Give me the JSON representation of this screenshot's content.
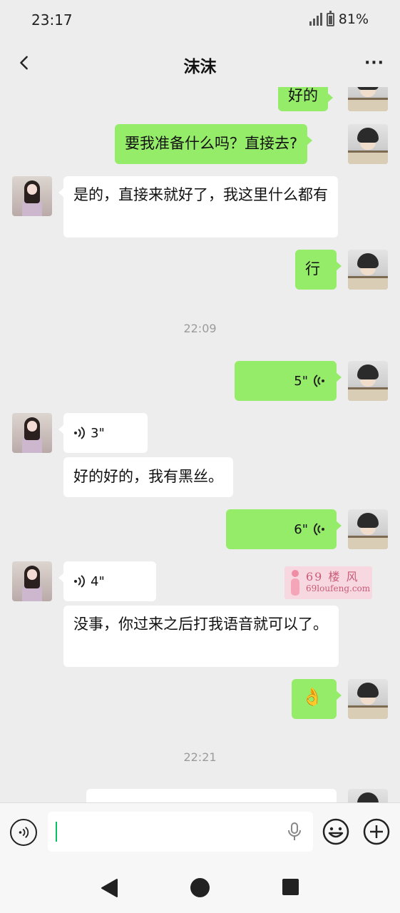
{
  "status_bar": {
    "time": "23:17",
    "battery_percent": "81%",
    "signal_icon": "cellular-signal-icon",
    "battery_icon": "battery-icon"
  },
  "nav": {
    "title": "沫沫",
    "back_icon": "chevron-left-icon",
    "more_label": "···"
  },
  "messages": [
    {
      "from": "me",
      "type": "text",
      "text": "好的"
    },
    {
      "from": "me",
      "type": "text",
      "text": "要我准备什么吗？直接去?"
    },
    {
      "from": "her",
      "type": "text",
      "text": "是的，直接来就好了，我这里什么都有"
    },
    {
      "from": "me",
      "type": "text",
      "text": "行"
    },
    {
      "type": "timestamp",
      "text": "22:09"
    },
    {
      "from": "me",
      "type": "voice",
      "duration": "5\""
    },
    {
      "from": "her",
      "type": "voice",
      "duration": "3\""
    },
    {
      "from": "her",
      "type": "text",
      "text": "好的好的，我有黑丝。"
    },
    {
      "from": "me",
      "type": "voice",
      "duration": "6\""
    },
    {
      "from": "her",
      "type": "voice",
      "duration": "4\""
    },
    {
      "from": "her",
      "type": "text",
      "text": "没事，你过来之后打我语音就可以了。"
    },
    {
      "from": "me",
      "type": "emoji",
      "emoji": "👌"
    },
    {
      "type": "timestamp",
      "text": "22:21"
    }
  ],
  "watermark": {
    "brand": "69 楼 风",
    "url": "69loufeng.com"
  },
  "input_bar": {
    "value": "",
    "voice_toggle_icon": "voice-mode-icon",
    "mic_icon": "microphone-icon",
    "emoji_icon": "emoji-face-icon",
    "plus_icon": "plus-circle-icon"
  },
  "system_nav": {
    "back_icon": "triangle-back-icon",
    "home_icon": "circle-home-icon",
    "recents_icon": "square-recents-icon"
  },
  "colors": {
    "outgoing_bubble": "#95ec69",
    "incoming_bubble": "#ffffff",
    "background": "#ededed",
    "caret": "#07c160"
  }
}
